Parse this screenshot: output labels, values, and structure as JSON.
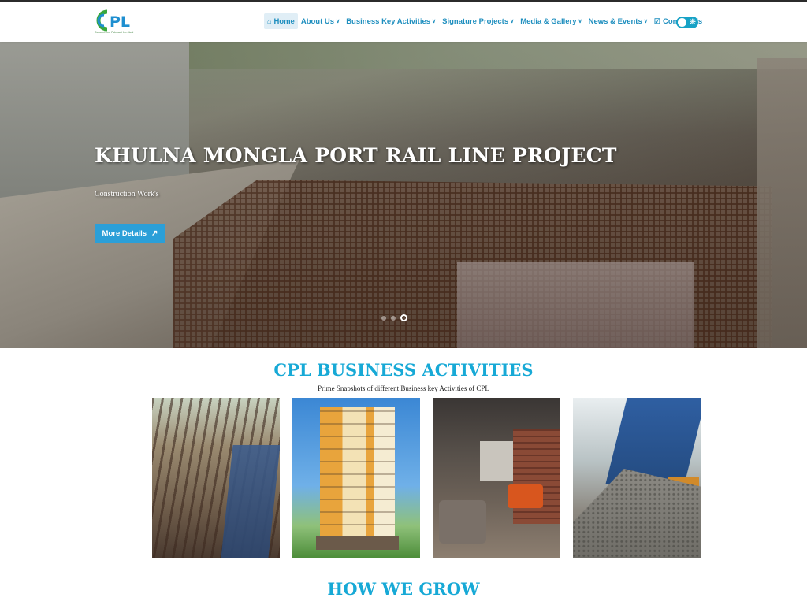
{
  "header": {
    "logo_text": "CPL",
    "logo_sub": "Consortium Pabnadi Limited",
    "nav": [
      {
        "label": "Home",
        "icon": "home-icon",
        "active": true,
        "dropdown": false
      },
      {
        "label": "About Us",
        "dropdown": true
      },
      {
        "label": "Business Key Activities",
        "dropdown": true
      },
      {
        "label": "Signature Projects",
        "dropdown": true
      },
      {
        "label": "Media & Gallery",
        "dropdown": true
      },
      {
        "label": "News & Events",
        "dropdown": true
      },
      {
        "label": "Contact Us",
        "icon": "contact-icon",
        "dropdown": false
      }
    ],
    "theme_toggle": {
      "icon": "sun-icon",
      "state": "light"
    }
  },
  "hero": {
    "title": "KHULNA MONGLA PORT RAIL LINE PROJECT",
    "subtitle": "Construction Work's",
    "button_label": "More Details",
    "button_icon": "arrow-up-right-icon",
    "slides_total": 3,
    "active_slide": 3
  },
  "business": {
    "title": "CPL BUSINESS ACTIVITIES",
    "subtitle": "Prime Snapshots of different Business key Activities of CPL",
    "cards": [
      {
        "image": "construction-site-photo"
      },
      {
        "image": "residential-building-photo"
      },
      {
        "image": "interior-design-photo"
      },
      {
        "image": "dump-truck-gravel-photo"
      }
    ]
  },
  "grow": {
    "title": "HOW WE GROW"
  },
  "colors": {
    "accent": "#17a9d6",
    "nav_text": "#1f8fbf",
    "button": "#2b9fd8",
    "logo_green": "#3aa83a",
    "logo_blue": "#1f8fd0"
  }
}
